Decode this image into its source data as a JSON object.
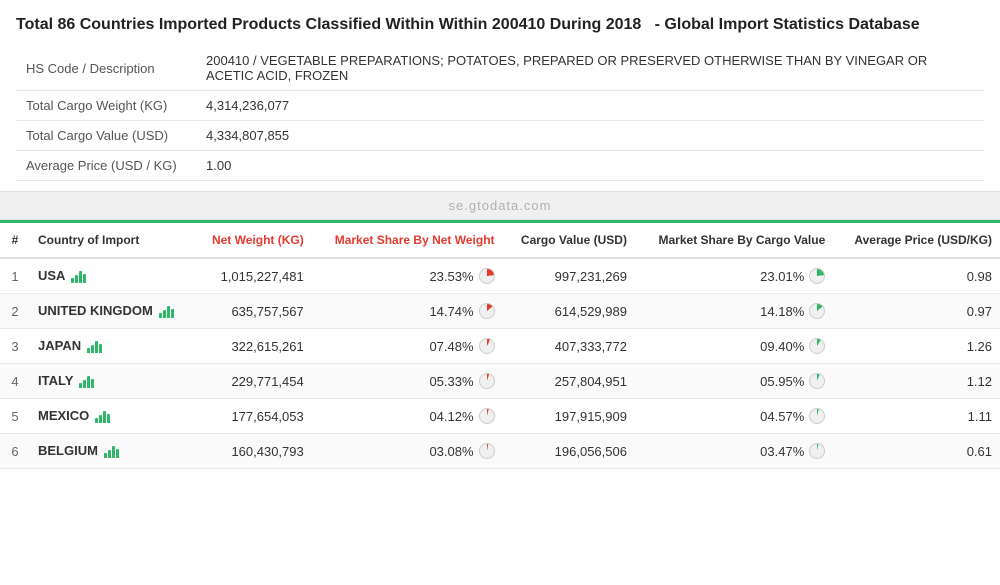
{
  "header": {
    "title_part1": "Total 86 Countries Imported Products Classified Within Within 200410 During 2018",
    "title_part2": "- Global Import Statistics Database"
  },
  "info_rows": [
    {
      "label": "HS Code / Description",
      "value": "200410 / VEGETABLE PREPARATIONS; POTATOES, PREPARED OR PRESERVED OTHERWISE THAN BY VINEGAR OR ACETIC ACID, FROZEN"
    },
    {
      "label": "Total Cargo Weight (KG)",
      "value": "4,314,236,077"
    },
    {
      "label": "Total Cargo Value (USD)",
      "value": "4,334,807,855"
    },
    {
      "label": "Average Price (USD / KG)",
      "value": "1.00"
    }
  ],
  "watermark": "se.gtodata.com",
  "table": {
    "columns": [
      {
        "label": "#",
        "red": false
      },
      {
        "label": "Country of Import",
        "red": false
      },
      {
        "label": "Net Weight (KG)",
        "red": true
      },
      {
        "label": "Market Share By Net Weight",
        "red": true
      },
      {
        "label": "Cargo Value (USD)",
        "red": false
      },
      {
        "label": "Market Share By Cargo Value",
        "red": false
      },
      {
        "label": "Average Price (USD/KG)",
        "red": false
      }
    ],
    "rows": [
      {
        "rank": "1",
        "country": "USA",
        "net_weight": "1,015,227,481",
        "market_share_weight": "23.53%",
        "cargo_value": "997,231,269",
        "market_share_value": "23.01%",
        "avg_price": "0.98",
        "pie_weight": "pct23",
        "pie_value": "pct23v"
      },
      {
        "rank": "2",
        "country": "UNITED KINGDOM",
        "net_weight": "635,757,567",
        "market_share_weight": "14.74%",
        "cargo_value": "614,529,989",
        "market_share_value": "14.18%",
        "avg_price": "0.97",
        "pie_weight": "pct14",
        "pie_value": "pct14v"
      },
      {
        "rank": "3",
        "country": "JAPAN",
        "net_weight": "322,615,261",
        "market_share_weight": "07.48%",
        "cargo_value": "407,333,772",
        "market_share_value": "09.40%",
        "avg_price": "1.26",
        "pie_weight": "pct7",
        "pie_value": "pct9v"
      },
      {
        "rank": "4",
        "country": "ITALY",
        "net_weight": "229,771,454",
        "market_share_weight": "05.33%",
        "cargo_value": "257,804,951",
        "market_share_value": "05.95%",
        "avg_price": "1.12",
        "pie_weight": "pct5",
        "pie_value": "pct6v"
      },
      {
        "rank": "5",
        "country": "MEXICO",
        "net_weight": "177,654,053",
        "market_share_weight": "04.12%",
        "cargo_value": "197,915,909",
        "market_share_value": "04.57%",
        "avg_price": "1.11",
        "pie_weight": "pct4",
        "pie_value": "pct4v"
      },
      {
        "rank": "6",
        "country": "BELGIUM",
        "net_weight": "160,430,793",
        "market_share_weight": "03.08%",
        "cargo_value": "196,056,506",
        "market_share_value": "03.47%",
        "avg_price": "0.61",
        "pie_weight": "pct3",
        "pie_value": "pct3v"
      }
    ]
  }
}
